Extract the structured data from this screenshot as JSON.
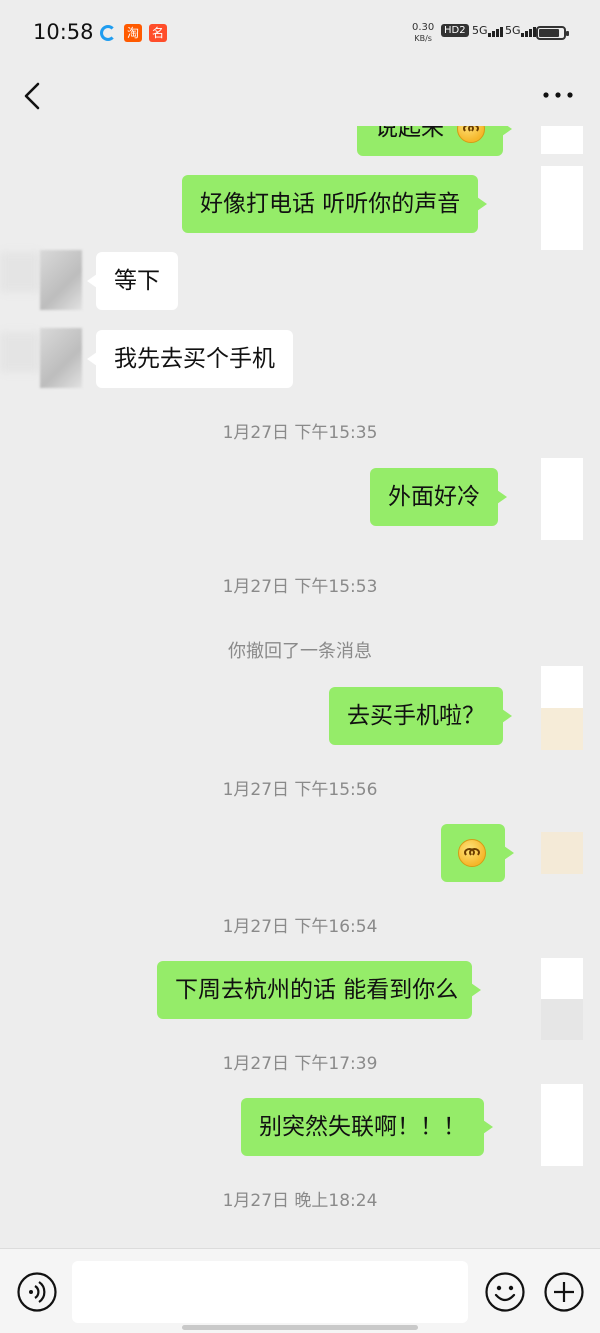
{
  "status_bar": {
    "time": "10:58",
    "app_icon_2_text": "淘",
    "app_icon_3_text": "名",
    "net_speed_value": "0.30",
    "net_speed_unit": "KB/s",
    "hd_label": "HD2",
    "signal1_label": "5G",
    "signal2_label": "5G"
  },
  "nav": {
    "back_icon": "chevron-left-icon",
    "more_icon": "more-dots-icon"
  },
  "messages": [
    {
      "side": "me",
      "text": "说起来",
      "has_emoji": true
    },
    {
      "side": "me",
      "text": "好像打电话 听听你的声音"
    },
    {
      "side": "them",
      "text": "等下"
    },
    {
      "side": "them",
      "text": "我先去买个手机"
    },
    {
      "type": "timestamp",
      "text": "1月27日 下午15:35"
    },
    {
      "side": "me",
      "text": "外面好冷"
    },
    {
      "type": "timestamp",
      "text": "1月27日 下午15:53"
    },
    {
      "type": "system",
      "text": "你撤回了一条消息"
    },
    {
      "side": "me",
      "text": "去买手机啦？"
    },
    {
      "type": "timestamp",
      "text": "1月27日 下午15:56"
    },
    {
      "side": "me",
      "emoji_only": true,
      "emoji": "smiling-face-emoji"
    },
    {
      "type": "timestamp",
      "text": "1月27日 下午16:54"
    },
    {
      "side": "me",
      "text": "下周去杭州的话 能看到你么"
    },
    {
      "type": "timestamp",
      "text": "1月27日 下午17:39"
    },
    {
      "side": "me",
      "text": "别突然失联啊！！！"
    },
    {
      "type": "timestamp",
      "text": "1月27日 晚上18:24"
    }
  ],
  "input_bar": {
    "voice_icon": "voice-icon",
    "input_value": "",
    "emoji_icon": "emoji-icon",
    "plus_icon": "plus-icon"
  },
  "colors": {
    "background": "#ededed",
    "bubble_me": "#95ec69",
    "bubble_them": "#ffffff",
    "timestamp_text": "#8a8a8a"
  }
}
